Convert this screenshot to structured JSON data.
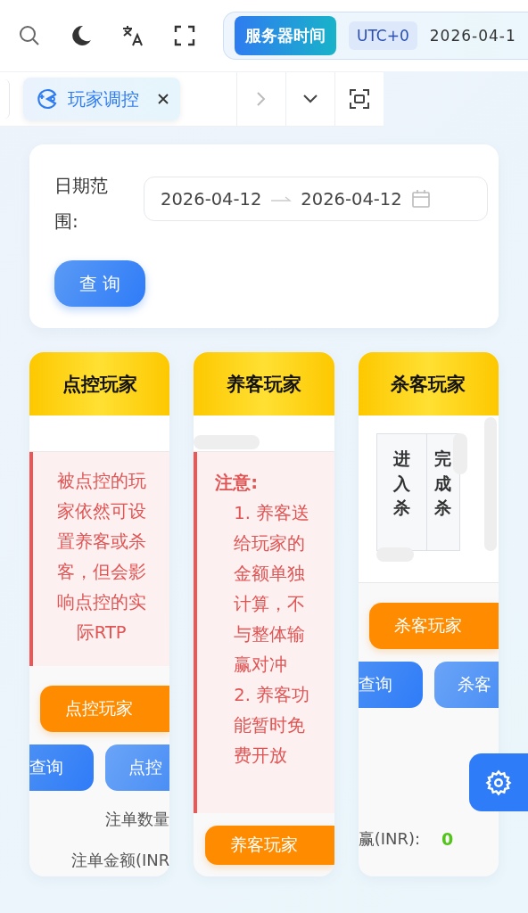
{
  "server_time": {
    "label": "服务器时间",
    "timezone": "UTC+0",
    "time": "2026-04-1"
  },
  "tabs": [
    {
      "label": "玩家调控",
      "selected": true
    }
  ],
  "filter": {
    "label": "日期范围:",
    "start": "2026-04-12",
    "end": "2026-04-12",
    "button": "查 询"
  },
  "cards": [
    {
      "title": "点控玩家",
      "note": {
        "kind": "centered",
        "text": "被点控的玩家依然可设置养客或杀客，但会影响点控的实际RTP"
      },
      "manage_button": "点控玩家",
      "buttons": [
        "查询",
        "点控"
      ],
      "stats": [
        {
          "label": "注单数量"
        },
        {
          "label": "注单金额(INR"
        }
      ]
    },
    {
      "title": "养客玩家",
      "note": {
        "kind": "list",
        "heading": "注意:",
        "items": [
          "1. 养客送给玩家的金额单独计算，不与整体输赢对冲",
          "2. 养客功能暂时免费开放"
        ]
      },
      "manage_button": "养客玩家"
    },
    {
      "title": "杀客玩家",
      "table": {
        "columns": [
          "进入杀",
          "完成杀"
        ]
      },
      "manage_button": "杀客玩家",
      "buttons": [
        "查询",
        "杀客"
      ],
      "stats": [
        {
          "label": "赢(INR):",
          "value": "0"
        }
      ]
    }
  ]
}
